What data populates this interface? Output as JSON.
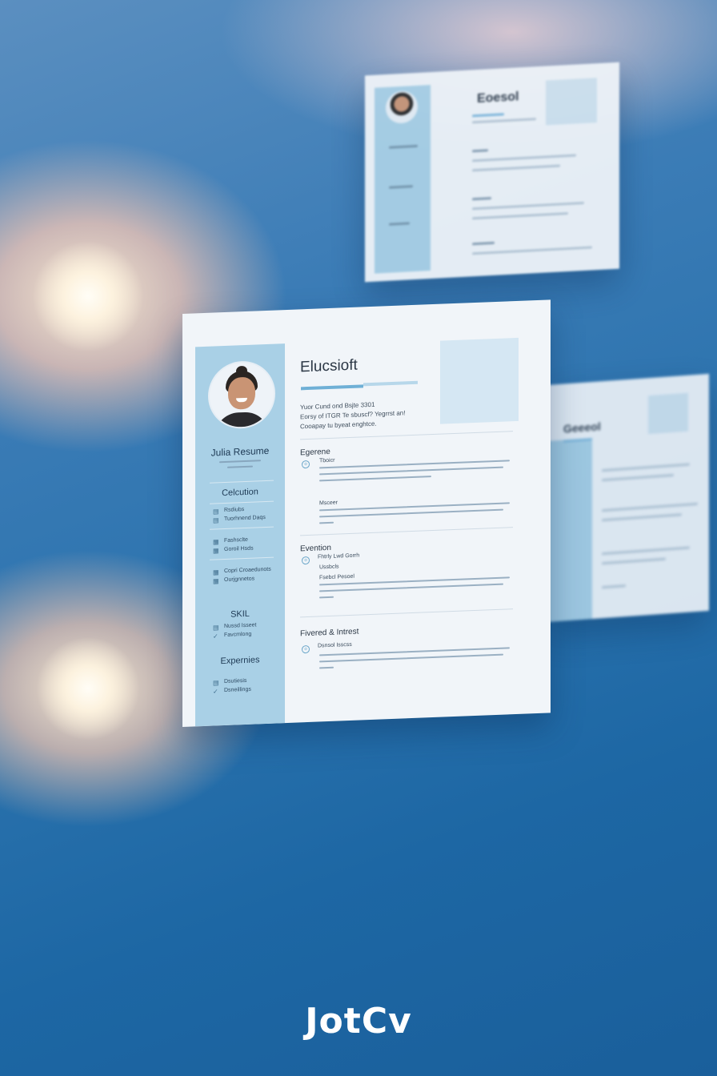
{
  "brand": "JotCv",
  "main_resume": {
    "title": "Elucsioft",
    "intro": [
      "Yuor Cund ond Bsjte 3301",
      "Eorsy of ITGR  Te sbuscf? Yegrrst an!",
      "Cooapay tu byeat enghtce."
    ],
    "sidebar": {
      "name": "Julia Resume",
      "sections": [
        {
          "heading": "Celcution",
          "items": [
            [
              "Rsdiubs",
              "Tuorhnend Daqs"
            ],
            [
              "Fashsclte",
              "Goroil Hsds"
            ],
            [
              "Copri Croaedunots",
              "Ourjgnnetos"
            ]
          ]
        },
        {
          "heading": "SKIL",
          "items": [
            [
              "Nussd Isseet",
              "Favcmlong"
            ]
          ]
        },
        {
          "heading": "Expernies",
          "items": [
            [
              "Dsutiesis",
              "Dsneillings"
            ]
          ]
        }
      ]
    },
    "sections": [
      {
        "heading": "Egerene",
        "entries": [
          {
            "label": "Tboicr"
          },
          {
            "label": "Msceer"
          }
        ]
      },
      {
        "heading": "Evention",
        "entries": [
          {
            "label": "Fhtrly Lwd Gorrh",
            "sub": [
              "Ussbcls",
              "Fsebcl Pesoel"
            ]
          }
        ]
      },
      {
        "heading": "Fivered & Intrest",
        "entries": [
          {
            "label": "Dsnsol Isscss"
          }
        ]
      }
    ]
  },
  "back_resumes": [
    {
      "title": "Eoesol"
    },
    {
      "title": "Geeeol"
    }
  ],
  "colors": {
    "sidebar": "#a9d0e6",
    "accent": "#6fb0d6",
    "sheet": "#f1f5f9",
    "background_deep": "#1d67a4"
  }
}
